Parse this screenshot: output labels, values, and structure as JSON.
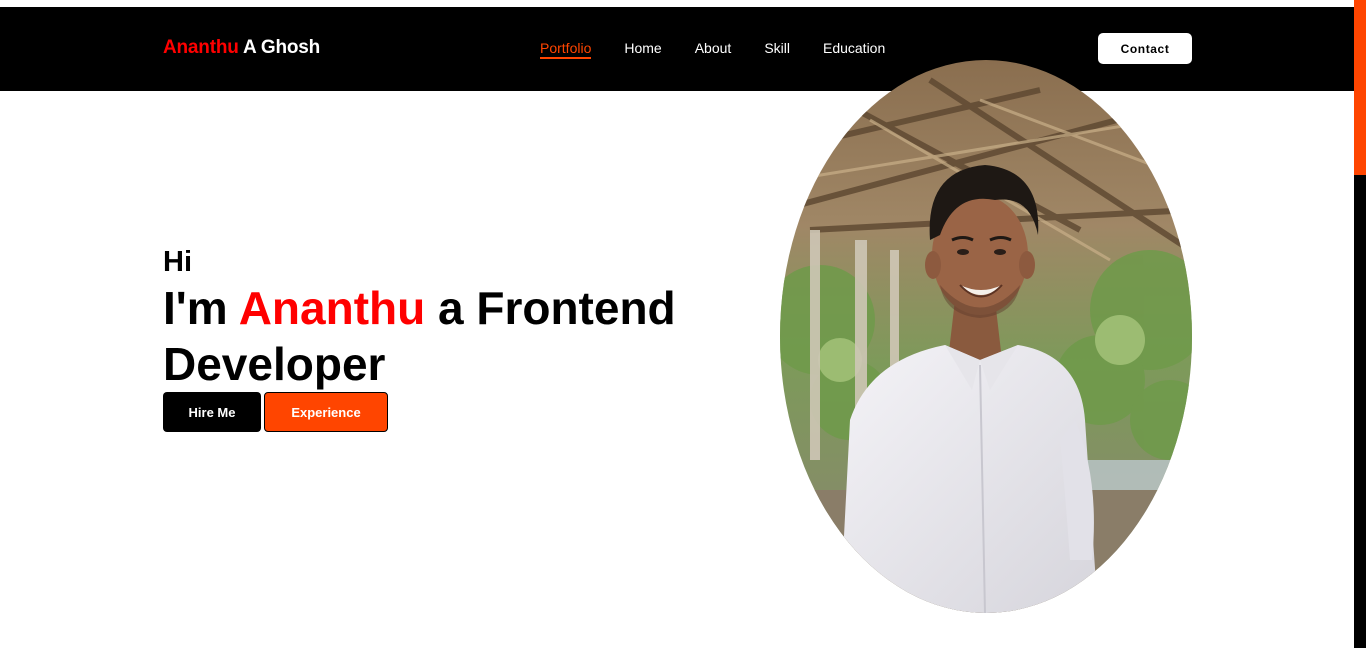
{
  "brand": {
    "first": "Ananthu",
    "rest": " A Ghosh"
  },
  "nav": {
    "items": [
      {
        "label": "Portfolio",
        "active": true
      },
      {
        "label": "Home",
        "active": false
      },
      {
        "label": "About",
        "active": false
      },
      {
        "label": "Skill",
        "active": false
      },
      {
        "label": "Education",
        "active": false
      }
    ],
    "contact_label": "Contact"
  },
  "hero": {
    "greeting": "Hi",
    "headline_pre": "I'm ",
    "headline_name": "Ananthu",
    "headline_post": " a Frontend Developer",
    "hire_label": "Hire Me",
    "experience_label": "Experience"
  },
  "portrait": {
    "icon": "profile-photo"
  },
  "colors": {
    "accent": "#ff4500",
    "name_red": "#ff0000",
    "nav_bg": "#000000"
  }
}
